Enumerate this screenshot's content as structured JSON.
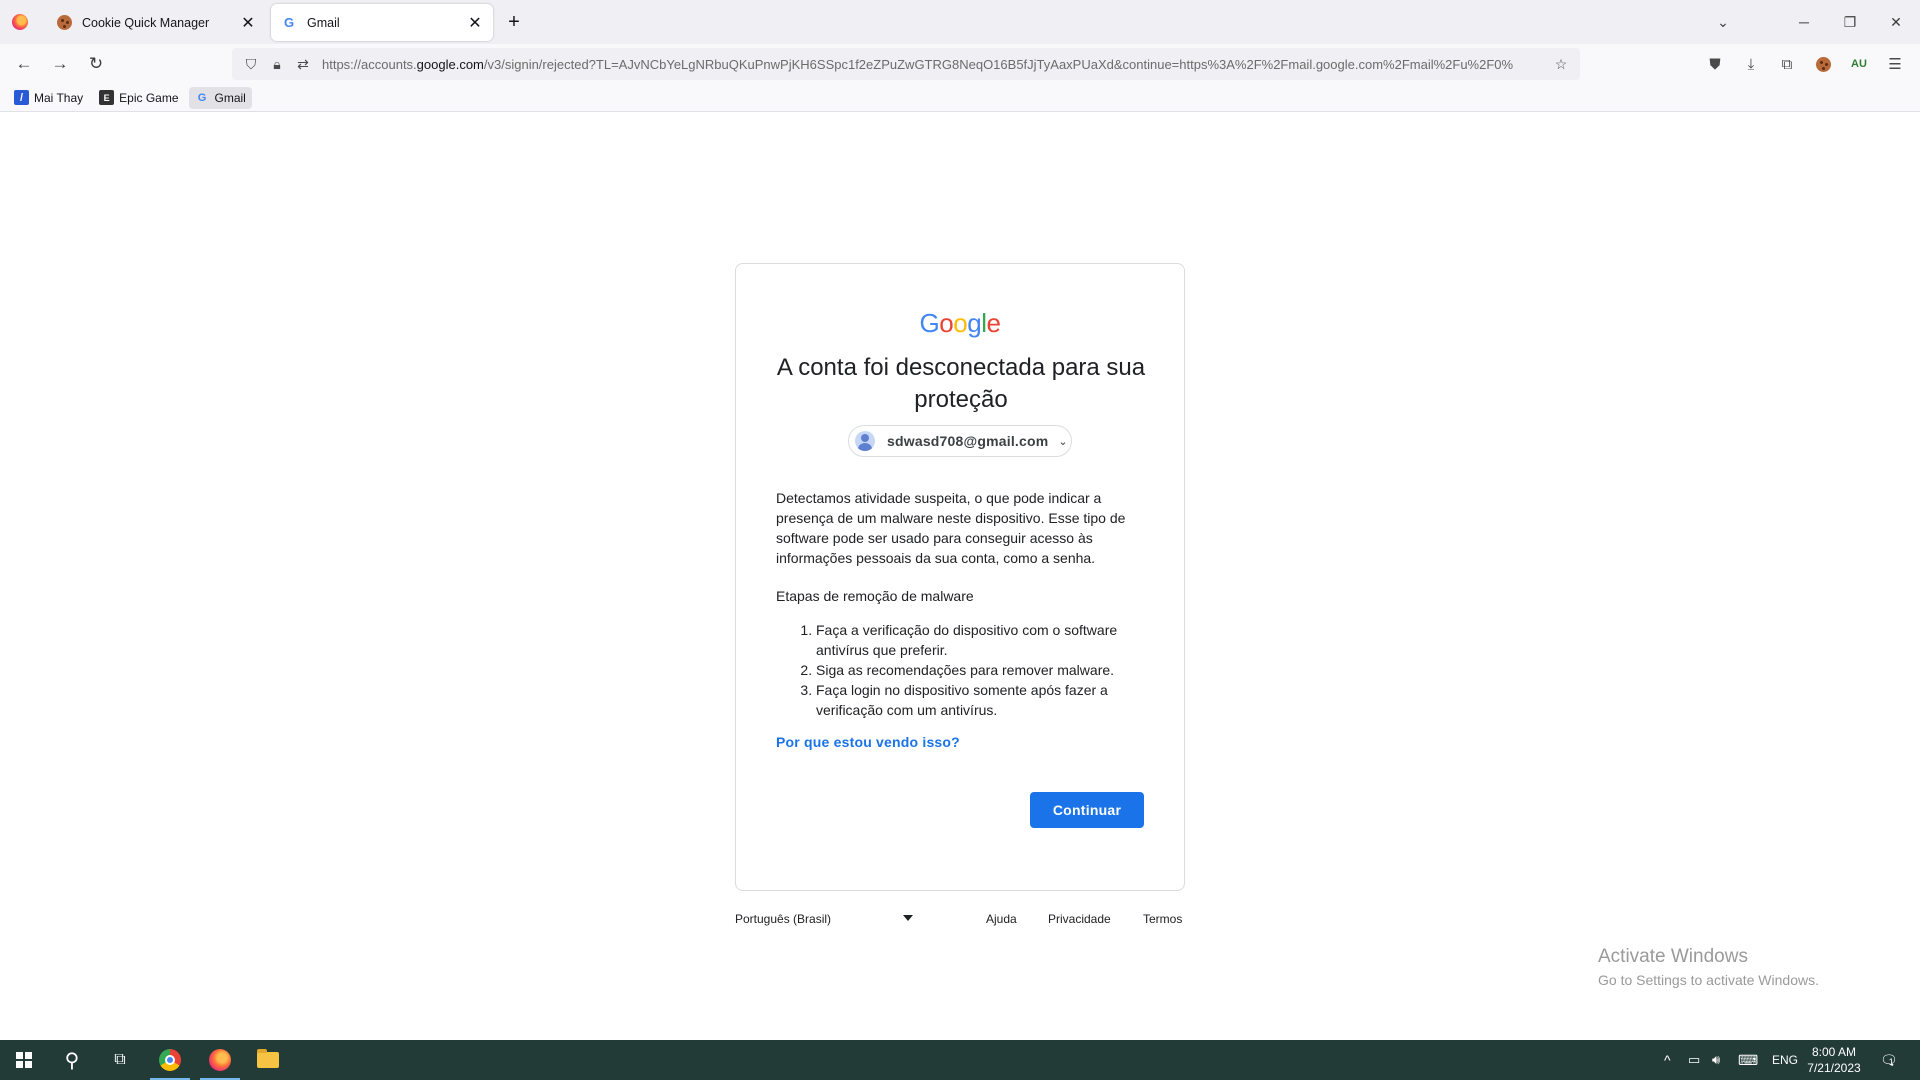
{
  "browser": {
    "tabs": [
      {
        "title": "Cookie Quick Manager",
        "favicon": "cookie-icon",
        "active": false
      },
      {
        "title": "Gmail",
        "favicon": "google-g-icon",
        "active": true
      }
    ],
    "url": {
      "prefix": "https://accounts.",
      "domain": "google.com",
      "suffix": "/v3/signin/rejected?TL=AJvNCbYeLgNRbuQKuPnwPjKH6SSpc1f2eZPuZwGTRG8NeqO16B5fJjTyAaxPUaXd&continue=https%3A%2F%2Fmail.google.com%2Fmail%2Fu%2F0%"
    },
    "bookmarks": [
      {
        "label": "Mai Thay",
        "icon": "slash-icon"
      },
      {
        "label": "Epic Game",
        "icon": "epic-icon"
      },
      {
        "label": "Gmail",
        "icon": "google-g-icon"
      }
    ]
  },
  "signin": {
    "logo": [
      "G",
      "o",
      "o",
      "g",
      "l",
      "e"
    ],
    "logo_colors": [
      "#4285f4",
      "#ea4335",
      "#fbbc05",
      "#4285f4",
      "#34a853",
      "#ea4335"
    ],
    "heading": "A conta foi desconectada para sua proteção",
    "email": "sdwasd708@gmail.com",
    "body": "Detectamos atividade suspeita, o que pode indicar a presença de um malware neste dispositivo. Esse tipo de software pode ser usado para conseguir acesso às informações pessoais da sua conta, como a senha.",
    "steps_title": "Etapas de remoção de malware",
    "steps": [
      "Faça a verificação do dispositivo com o software antivírus que preferir.",
      "Siga as recomendações para remover malware.",
      "Faça login no dispositivo somente após fazer a verificação com um antivírus."
    ],
    "why_link": "Por que estou vendo isso?",
    "continue_label": "Continuar"
  },
  "footer": {
    "language": "Português (Brasil)",
    "help": "Ajuda",
    "privacy": "Privacidade",
    "terms": "Termos"
  },
  "watermark": {
    "line1": "Activate Windows",
    "line2": "Go to Settings to activate Windows."
  },
  "taskbar": {
    "language": "ENG",
    "time": "8:00 AM",
    "date": "7/21/2023",
    "notification_count": "1"
  },
  "colors": {
    "accent": "#1a73e8",
    "taskbar": "#233b36"
  }
}
